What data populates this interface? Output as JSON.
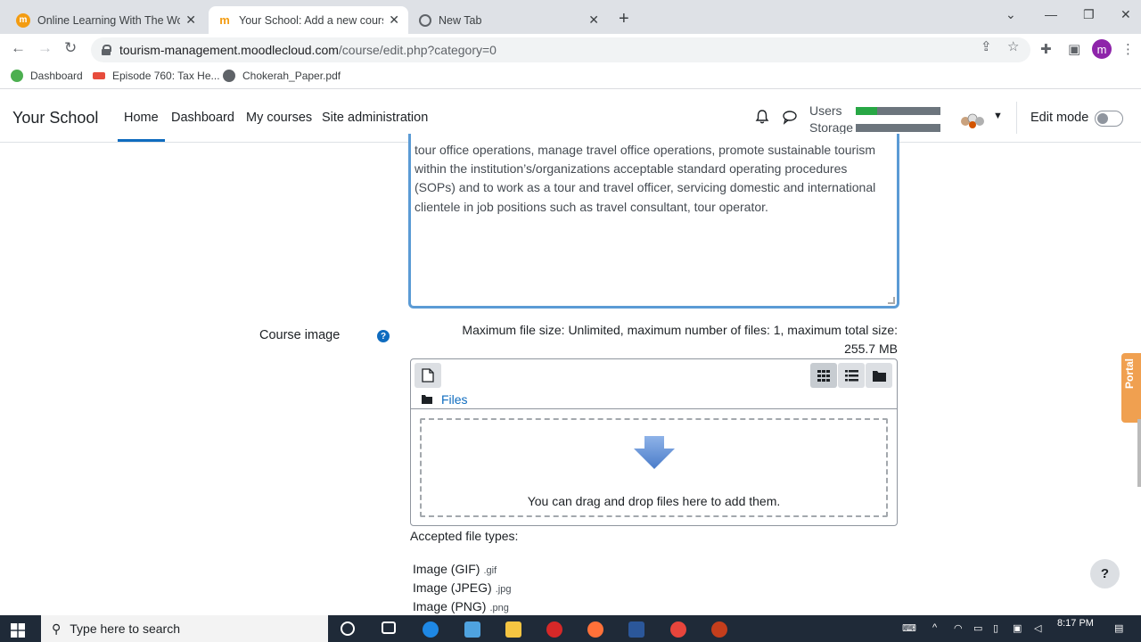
{
  "browser": {
    "tabs": [
      {
        "title": "Online Learning With The World's",
        "active": false
      },
      {
        "title": "Your School: Add a new course",
        "active": true
      },
      {
        "title": "New Tab",
        "active": false
      }
    ],
    "url_host": "tourism-management.moodlecloud.com",
    "url_path": "/course/edit.php?category=0",
    "bookmarks": [
      "Dashboard",
      "Episode 760: Tax He...",
      "Chokerah_Paper.pdf"
    ],
    "profile_initial": "m"
  },
  "navbar": {
    "brand": "Your School",
    "links": [
      "Home",
      "Dashboard",
      "My courses",
      "Site administration"
    ],
    "quota": {
      "users_label": "Users",
      "storage_label": "Storage",
      "users_fraction": 0.25,
      "storage_fraction": 0.0
    },
    "edit_mode_label": "Edit mode"
  },
  "editor": {
    "text": "tour office operations, manage travel office operations, promote sustainable tourism within the institution’s/organizations acceptable standard operating procedures (SOPs) and to work as a tour and travel officer, servicing domestic and international clientele in job positions such as travel consultant, tour operator."
  },
  "course_image": {
    "label": "Course image",
    "max_size_line1": "Maximum file size: Unlimited, maximum number of files: 1, maximum total size:",
    "max_size_line2": "255.7 MB",
    "crumb": "Files",
    "drop_text": "You can drag and drop files here to add them.",
    "accepted_label": "Accepted file types:",
    "file_types": [
      {
        "name": "Image (GIF)",
        "ext": ".gif"
      },
      {
        "name": "Image (JPEG)",
        "ext": ".jpg"
      },
      {
        "name": "Image (PNG)",
        "ext": ".png"
      }
    ]
  },
  "help_button": "?",
  "portal_label": "Portal",
  "taskbar": {
    "search_placeholder": "Type here to search",
    "time": "8:17 PM"
  },
  "colors": {
    "primary": "#0f6cbf",
    "editor_border": "#5b9bd5",
    "quota_fill": "#28a745"
  }
}
